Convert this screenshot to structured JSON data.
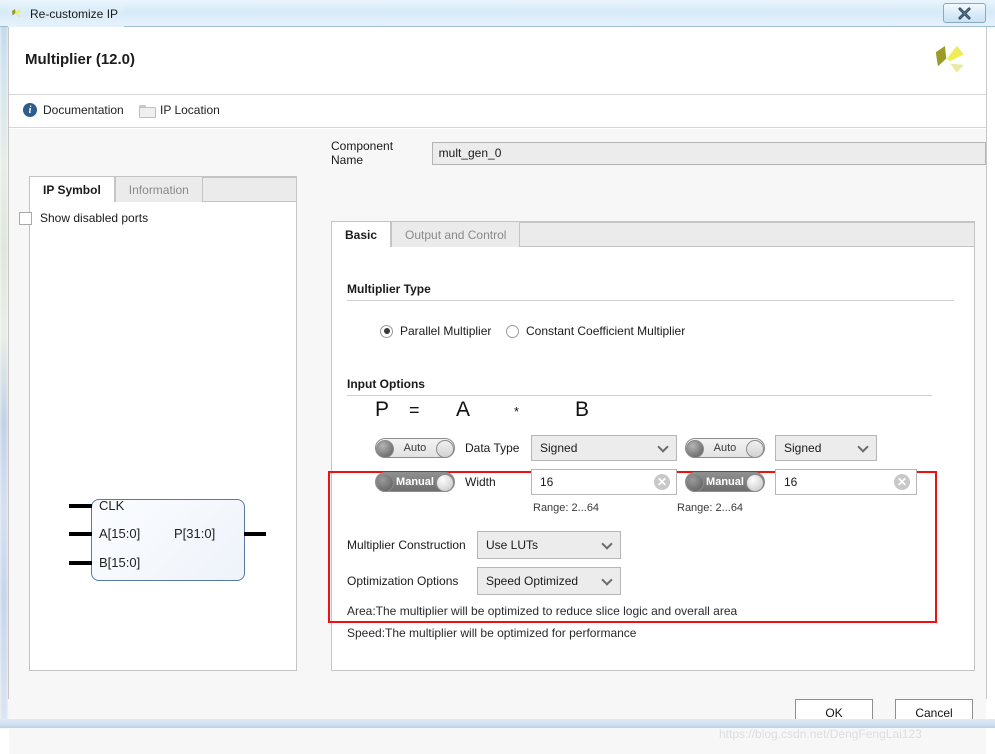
{
  "window": {
    "title": "Re-customize IP",
    "close_label": "✖",
    "app_icon": "xilinx-logo-icon"
  },
  "header": {
    "ip_title": "Multiplier (12.0)",
    "logo": "xilinx-logo-icon"
  },
  "links": {
    "documentation": "Documentation",
    "ip_location": "IP Location",
    "info_icon": "info-icon",
    "folder_icon": "folder-icon"
  },
  "left_panel": {
    "tabs": [
      {
        "label": "IP Symbol",
        "active": true
      },
      {
        "label": "Information",
        "active": false
      }
    ],
    "show_disabled_ports": {
      "label": "Show disabled ports",
      "checked": false
    },
    "symbol": {
      "inputs": [
        "CLK",
        "A[15:0]",
        "B[15:0]"
      ],
      "outputs": [
        "P[31:0]"
      ]
    }
  },
  "component_name": {
    "label": "Component Name",
    "value": "mult_gen_0",
    "placeholder": "mult_gen_0"
  },
  "right_panel": {
    "tabs": [
      {
        "label": "Basic",
        "active": true
      },
      {
        "label": "Output and Control",
        "active": false
      }
    ],
    "multiplier_type": {
      "title": "Multiplier Type",
      "options": [
        {
          "label": "Parallel Multiplier",
          "selected": true
        },
        {
          "label": "Constant Coefficient Multiplier",
          "selected": false
        }
      ]
    },
    "input_options": {
      "title": "Input Options",
      "highlight_color": "#ee1111",
      "equation": {
        "p": "P",
        "eq": "=",
        "a": "A",
        "op": "*",
        "b": "B"
      },
      "labels": {
        "data_type": "Data Type",
        "width": "Width"
      },
      "operand_a": {
        "data_type_mode": {
          "label": "Auto",
          "state": "off"
        },
        "data_type_value": "Signed",
        "width_mode": {
          "label": "Manual",
          "state": "on"
        },
        "width_value": "16",
        "range": "Range: 2...64"
      },
      "operand_b": {
        "data_type_mode": {
          "label": "Auto",
          "state": "off"
        },
        "data_type_value": "Signed",
        "width_mode": {
          "label": "Manual",
          "state": "on"
        },
        "width_value": "16",
        "range": "Range: 2...64"
      }
    },
    "multiplier_construction": {
      "label": "Multiplier Construction",
      "value": "Use LUTs"
    },
    "optimization_options": {
      "label": "Optimization Options",
      "value": "Speed Optimized"
    },
    "descriptions": [
      "Area:The multiplier will be optimized to reduce slice logic and overall area",
      "Speed:The multiplier will be optimized for performance"
    ]
  },
  "footer": {
    "ok": "OK",
    "cancel": "Cancel",
    "watermark": "https://blog.csdn.net/DengFengLai123"
  }
}
